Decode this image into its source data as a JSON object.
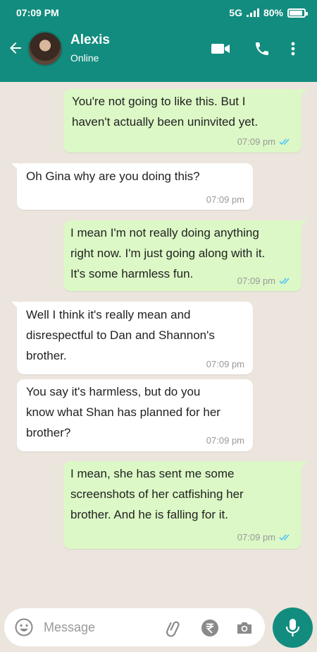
{
  "status_bar": {
    "time": "07:09 PM",
    "network": "5G",
    "battery": "80%",
    "battery_level": 0.8
  },
  "header": {
    "contact_name": "Alexis",
    "contact_status": "Online",
    "icons": [
      "back-arrow-icon",
      "video-call-icon",
      "phone-call-icon",
      "more-options-icon"
    ]
  },
  "messages": [
    {
      "direction": "out",
      "text": "You're not going to like this. But I haven't actually been uninvited yet.",
      "lines": [
        "You're not going to like this. But I",
        "haven't actually been uninvited yet."
      ],
      "time": "07:09 pm",
      "read": true
    },
    {
      "direction": "in",
      "text": "Oh Gina why are you doing this?",
      "lines": [
        "Oh Gina why are you doing this?"
      ],
      "time": "07:09 pm"
    },
    {
      "direction": "out",
      "text": "I mean I'm not really doing anything right now. I'm just going along with it. It's some harmless fun.",
      "lines": [
        "I mean I'm not really doing anything",
        "right now. I'm just going along with it.",
        "It's some harmless fun."
      ],
      "time": "07:09 pm",
      "read": true
    },
    {
      "direction": "in",
      "text": "Well I think it's really mean and disrespectful to Dan and Shannon's brother.",
      "lines": [
        "Well I think it's really mean and",
        "disrespectful to Dan and Shannon's",
        "brother."
      ],
      "time": "07:09 pm"
    },
    {
      "direction": "in",
      "text": "You say it's harmless, but do you know what Shan has planned for her brother?",
      "lines": [
        "You say it's harmless, but do you",
        "know what Shan has planned for her",
        "brother?"
      ],
      "time": "07:09 pm"
    },
    {
      "direction": "out",
      "text": "I mean, she has sent me some screenshots of  her catfishing her brother. And he is falling for it.",
      "lines": [
        "I mean, she has sent me some",
        "screenshots of  her catfishing her",
        "brother. And he is falling for it."
      ],
      "time": "07:09 pm",
      "read": true
    }
  ],
  "input": {
    "placeholder": "Message",
    "icons": [
      "emoji-icon",
      "attach-icon",
      "rupee-payment-icon",
      "camera-icon",
      "mic-icon"
    ]
  },
  "colors": {
    "header": "#128c7e",
    "outgoing_bubble": "#dcf8c6",
    "incoming_bubble": "#ffffff",
    "chat_background": "#ece5dd",
    "read_ticks": "#4fc3f7"
  }
}
